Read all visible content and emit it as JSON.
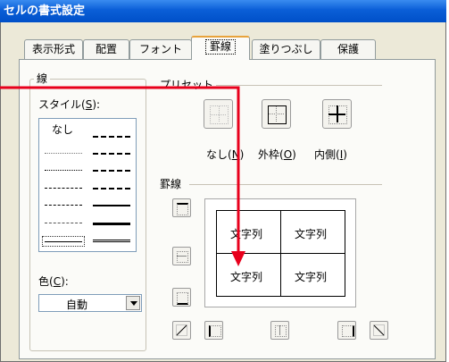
{
  "window": {
    "title": "セルの書式設定"
  },
  "tabs": [
    {
      "label": "表示形式"
    },
    {
      "label": "配置"
    },
    {
      "label": "フォント"
    },
    {
      "label": "罫線"
    },
    {
      "label": "塗りつぶし"
    },
    {
      "label": "保護"
    }
  ],
  "line_group": {
    "title": "線",
    "style_label": "スタイル(",
    "style_key": "S",
    "style_suffix": "):",
    "none_label": "なし",
    "color_label": "色(",
    "color_key": "C",
    "color_suffix": "):",
    "color_value": "自動"
  },
  "preset_group": {
    "title": "プリセット",
    "none_label": "なし(",
    "none_key": "N",
    "none_suffix": ")",
    "outline_label": "外枠(",
    "outline_key": "O",
    "outline_suffix": ")",
    "inside_label": "内側(",
    "inside_key": "I",
    "inside_suffix": ")"
  },
  "border_group": {
    "title": "罫線"
  },
  "preview": {
    "cells": [
      "文字列",
      "文字列",
      "文字列",
      "文字列"
    ]
  },
  "colors": {
    "annotation_arrow": "#e8001c",
    "titlebar": "#0a5ed7",
    "active_tab_accent": "#e8a33c"
  }
}
